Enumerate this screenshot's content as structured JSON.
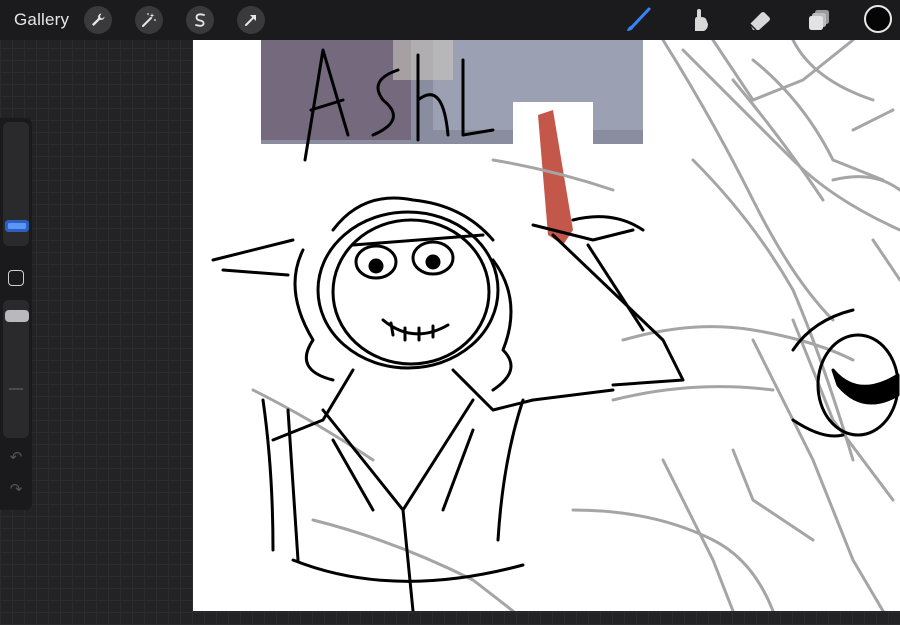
{
  "app": {
    "gallery_label": "Gallery"
  },
  "toolbar": {
    "actions": [
      {
        "name": "actions",
        "icon": "wrench-icon"
      },
      {
        "name": "adjustments",
        "icon": "magic-wand-icon"
      },
      {
        "name": "selection",
        "icon": "selection-s-icon"
      },
      {
        "name": "transform",
        "icon": "transform-arrow-icon"
      }
    ],
    "tools": [
      {
        "name": "brush",
        "icon": "brush-icon",
        "active": true
      },
      {
        "name": "smudge",
        "icon": "smudge-finger-icon",
        "active": false
      },
      {
        "name": "eraser",
        "icon": "eraser-icon",
        "active": false
      },
      {
        "name": "layers",
        "icon": "layers-icon",
        "active": false
      }
    ],
    "current_color": "#050505"
  },
  "sidebar": {
    "brush_size_level": 0.25,
    "opacity_level": 0.15,
    "undo_icon": "undo-icon",
    "redo_icon": "redo-icon"
  },
  "colors": {
    "accent": "#3a82f7",
    "topbar": "#1b1b1d",
    "canvas": "#ffffff"
  },
  "canvas": {
    "sketch_text": "Ash"
  }
}
